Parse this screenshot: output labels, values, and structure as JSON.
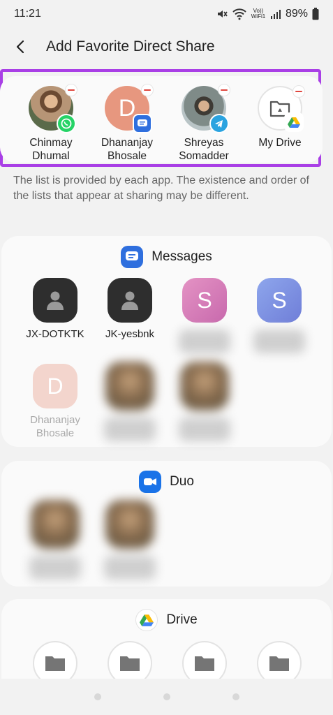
{
  "status_bar": {
    "time": "11:21",
    "network_label": "Vo)) WiFi1",
    "battery": "89%",
    "icons": [
      "mute-icon",
      "wifi-icon",
      "signal-icon",
      "battery-icon"
    ]
  },
  "header": {
    "title": "Add Favorite Direct Share",
    "back_icon": "back-arrow-icon"
  },
  "favorites": [
    {
      "line1": "Chinmay",
      "line2": "Dhumal",
      "avatar": "photo",
      "badge": "whatsapp-icon",
      "badge_color": "#25d366"
    },
    {
      "line1": "Dhananjay",
      "line2": "Bhosale",
      "avatar_letter": "D",
      "avatar_color": "#e7977f",
      "badge": "messages-icon",
      "badge_color": "#2f6fde"
    },
    {
      "line1": "Shreyas",
      "line2": "Somadder",
      "avatar": "photo",
      "badge": "telegram-icon",
      "badge_color": "#2aa3e0"
    },
    {
      "line1": "My Drive",
      "line2": "",
      "avatar": "folder",
      "badge": "google-drive-icon",
      "badge_color": "#ffffff"
    }
  ],
  "info_text": "The list is provided by each app. The existence and order of the lists that appear at sharing may be different.",
  "messages": {
    "app_name": "Messages",
    "contacts": [
      {
        "label": "JX-DOTKTK",
        "avatar": "person"
      },
      {
        "label": "JK-yesbnk",
        "avatar": "person"
      },
      {
        "letter": "S",
        "color": "#d277b8"
      },
      {
        "letter": "S",
        "color": "#7b8ee0"
      },
      {
        "letter": "D",
        "label_line1": "Dhananjay",
        "label_line2": "Bhosale",
        "color": "#f0cfc7"
      }
    ]
  },
  "duo": {
    "app_name": "Duo"
  },
  "drive": {
    "app_name": "Drive"
  },
  "colors": {
    "highlight_border": "#a93fe6",
    "messages_blue": "#2f6fde",
    "duo_blue": "#1a73e8",
    "remove_red": "#e0463e"
  }
}
